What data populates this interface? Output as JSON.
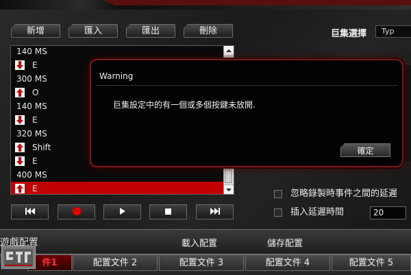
{
  "toolbar": {
    "new_label": "新增",
    "import_label": "匯入",
    "export_label": "匯出",
    "delete_label": "刪除"
  },
  "macro": {
    "label": "巨集選擇",
    "select_value": "Typ"
  },
  "event_list": [
    {
      "type": "delay",
      "text": "140 MS"
    },
    {
      "type": "down",
      "text": "E"
    },
    {
      "type": "delay",
      "text": "300 MS"
    },
    {
      "type": "up",
      "text": "O"
    },
    {
      "type": "delay",
      "text": "140 MS"
    },
    {
      "type": "down",
      "text": "E"
    },
    {
      "type": "delay",
      "text": "320 MS"
    },
    {
      "type": "up",
      "text": "Shift"
    },
    {
      "type": "down",
      "text": "E"
    },
    {
      "type": "delay",
      "text": "400 MS"
    },
    {
      "type": "up",
      "text": "E",
      "selected": true
    }
  ],
  "transport": {
    "icons": [
      "skip-back-icon",
      "record-icon",
      "play-icon",
      "stop-icon",
      "skip-forward-icon"
    ],
    "record_color": "#e00000"
  },
  "options": {
    "ignore_delay_label": "忽略錄製時事件之間的延遲",
    "insert_delay_label": "插入延遲時間",
    "insert_delay_value": "20"
  },
  "upper_tabs": {
    "game_label": "遊戲配置",
    "load_label": "載入配置",
    "save_label": "儲存配置"
  },
  "profile_tabs": [
    {
      "label": "件1",
      "active": true
    },
    {
      "label": "配置文件 2"
    },
    {
      "label": "配置文件 3"
    },
    {
      "label": "配置文件 4"
    },
    {
      "label": "配置文件 5"
    }
  ],
  "dialog": {
    "title": "Warning",
    "message": "巨集設定中的有一個或多個按鍵未放開.",
    "ok_label": "確定"
  },
  "colors": {
    "accent_red": "#c00000",
    "dialog_border": "#7a1818"
  }
}
